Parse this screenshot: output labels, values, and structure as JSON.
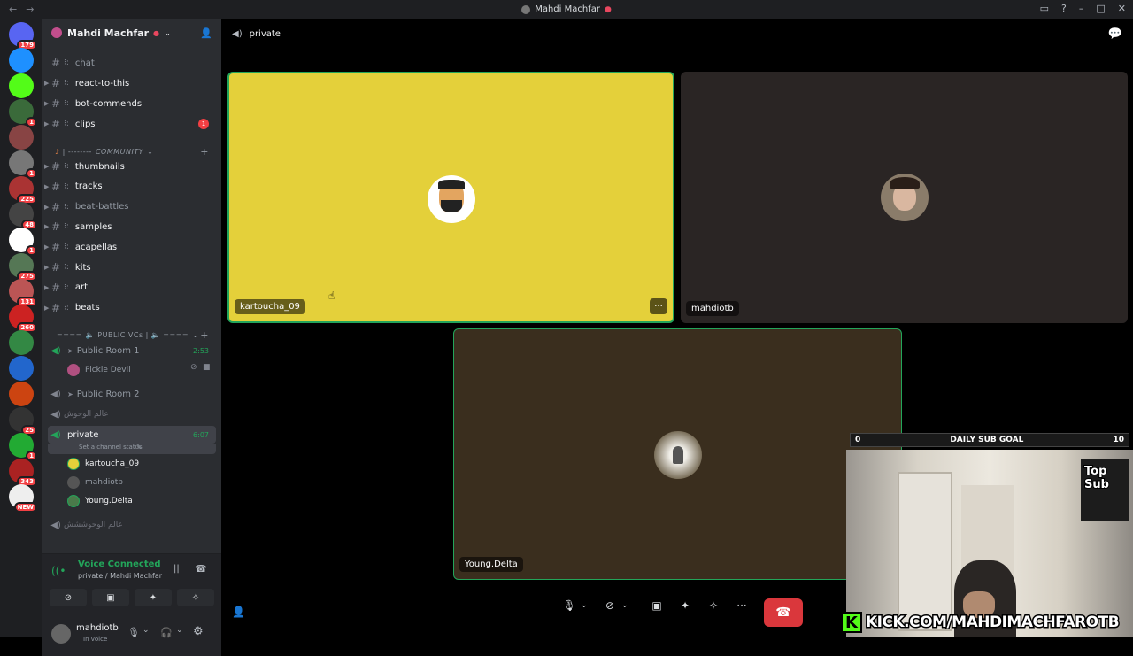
{
  "window": {
    "title": "Mahdi Machfar"
  },
  "guilds": [
    {
      "badge": "179",
      "color": "#5865f2"
    },
    {
      "badge": "",
      "color": "#1e90ff"
    },
    {
      "badge": "",
      "color": "#53fc18"
    },
    {
      "badge": "1",
      "color": "#3a6a3a"
    },
    {
      "badge": "",
      "color": "#884444"
    },
    {
      "badge": "1",
      "color": "#777777"
    },
    {
      "badge": "225",
      "color": "#aa3333"
    },
    {
      "badge": "48",
      "color": "#444444"
    },
    {
      "badge": "1",
      "color": "#ffffff"
    },
    {
      "badge": "275",
      "color": "#557755"
    },
    {
      "badge": "131",
      "color": "#bb5555"
    },
    {
      "badge": "260",
      "color": "#cc2222"
    },
    {
      "badge": "",
      "color": "#338844"
    },
    {
      "badge": "",
      "color": "#2266cc"
    },
    {
      "badge": "",
      "color": "#cc4411"
    },
    {
      "badge": "25",
      "color": "#333333"
    },
    {
      "badge": "1",
      "color": "#22aa33"
    },
    {
      "badge": "343",
      "color": "#aa2222"
    },
    {
      "badge": "NEW",
      "color": "#eeeeee"
    }
  ],
  "server": {
    "name": "Mahdi Machfar"
  },
  "channels": [
    {
      "name": "chat",
      "bright": false,
      "badge": ""
    },
    {
      "name": "react-to-this",
      "bright": true,
      "badge": ""
    },
    {
      "name": "bot-commends",
      "bright": true,
      "badge": ""
    },
    {
      "name": "clips",
      "bright": true,
      "badge": "1"
    }
  ],
  "community_category": "COMMUNITY",
  "community_channels": [
    {
      "name": "thumbnails",
      "bright": true
    },
    {
      "name": "tracks",
      "bright": true
    },
    {
      "name": "beat-battles",
      "bright": false
    },
    {
      "name": "samples",
      "bright": true
    },
    {
      "name": "acapellas",
      "bright": true
    },
    {
      "name": "kits",
      "bright": true
    },
    {
      "name": "art",
      "bright": true
    },
    {
      "name": "beats",
      "bright": true
    }
  ],
  "vc_category": "PUBLIC VCs",
  "voice_channels": {
    "public_room_1": {
      "name": "Public Room 1",
      "time": "2:53",
      "member": "Pickle Devil"
    },
    "public_room_2": {
      "name": "Public Room 2"
    },
    "arabic_1": {
      "name": "عالم الوحوش"
    },
    "private": {
      "name": "private",
      "time": "6:07",
      "status": "Set a channel status",
      "members": [
        "kartoucha_09",
        "mahdiotb",
        "Young.Delta"
      ]
    },
    "arabic_2": {
      "name": "عالم الوحوششش"
    }
  },
  "voice_panel": {
    "status": "Voice Connected",
    "location": "private / Mahdi Machfar"
  },
  "user": {
    "name": "mahdiotb",
    "status": "In voice"
  },
  "main": {
    "channel_name": "private"
  },
  "tiles": [
    {
      "name": "kartoucha_09",
      "bg": "#e4d03a"
    },
    {
      "name": "mahdiotb",
      "bg": "#2a2524"
    },
    {
      "name": "Young.Delta",
      "bg": "#3a2e1e"
    }
  ],
  "overlay": {
    "goal_min": "0",
    "goal_label": "DAILY SUB GOAL",
    "goal_max": "10",
    "top_sub": "Top Sub",
    "kick_text": "KICK.COM/MAHDIMACHFAROTB"
  }
}
